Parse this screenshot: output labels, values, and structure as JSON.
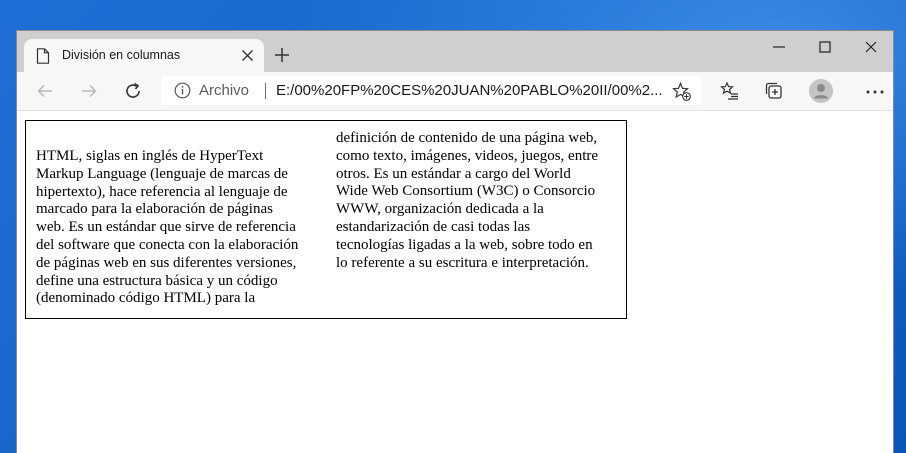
{
  "tab": {
    "title": "División en columnas"
  },
  "address": {
    "scheme_label": "Archivo",
    "url": "E:/00%20FP%20CES%20JUAN%20PABLO%20II/00%2..."
  },
  "icons": {
    "tab": "page-icon",
    "tab_close": "close-icon",
    "new_tab": "plus-icon",
    "minimize": "minimize-icon",
    "maximize": "maximize-icon",
    "close": "close-icon",
    "back": "back-arrow-icon",
    "forward": "forward-arrow-icon",
    "refresh": "refresh-icon",
    "site_info": "info-icon",
    "add_favorite": "star-plus-icon",
    "favorites": "favorites-list-icon",
    "collections": "collections-icon",
    "profile": "profile-avatar-icon",
    "more": "more-dots-icon"
  },
  "colors": {
    "desktop": "#1565c9",
    "titlebar": "#cfcfcf",
    "toolbar": "#f7f7f7"
  },
  "content": {
    "column1": [
      "HTML, siglas en inglés de HyperText",
      "Markup Language (lenguaje de marcas de",
      "hipertexto), hace referencia al lenguaje de",
      "marcado para la elaboración de páginas",
      "web. Es un estándar que sirve de referencia",
      "del software que conecta con la elaboración",
      "de páginas web en sus diferentes versiones,",
      "define una estructura básica y un código",
      "(denominado código HTML) para la"
    ],
    "column2": [
      "definición de contenido de una página web,",
      "como texto, imágenes, videos, juegos, entre",
      "otros. Es un estándar a cargo del World",
      "Wide Web Consortium (W3C) o Consorcio",
      "WWW, organización dedicada a la",
      "estandarización de casi todas las",
      "tecnologías ligadas a la web, sobre todo en",
      "lo referente a su escritura e interpretación."
    ]
  }
}
